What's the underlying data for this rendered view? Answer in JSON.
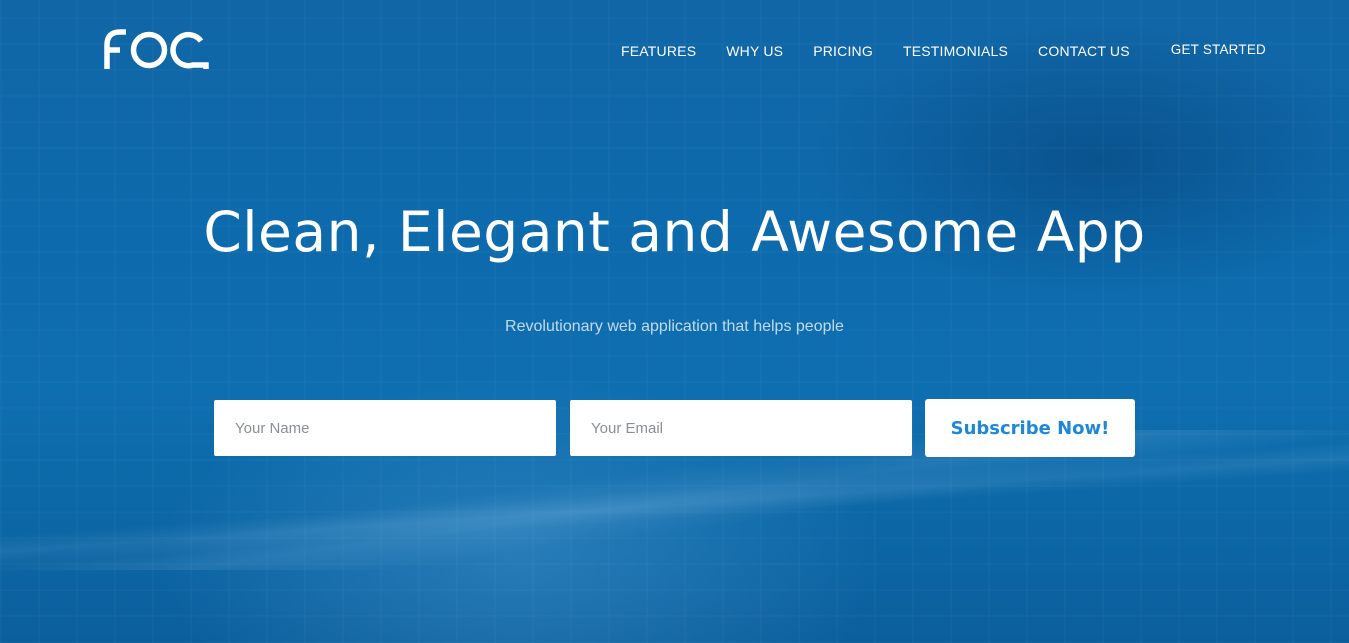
{
  "brand": {
    "logo_text": "FOG",
    "logo_color": "#ffffff"
  },
  "nav": {
    "items": [
      {
        "label": "FEATURES"
      },
      {
        "label": "WHY US"
      },
      {
        "label": "PRICING"
      },
      {
        "label": "TESTIMONIALS"
      },
      {
        "label": "CONTACT US"
      }
    ],
    "cta_label": "GET STARTED"
  },
  "hero": {
    "headline": "Clean, Elegant and Awesome App",
    "subtitle": "Revolutionary web application that helps people",
    "background_color": "#0e6fb0"
  },
  "form": {
    "name_placeholder": "Your Name",
    "email_placeholder": "Your Email",
    "submit_label": "Subscribe Now!",
    "submit_text_color": "#1e88d8"
  }
}
